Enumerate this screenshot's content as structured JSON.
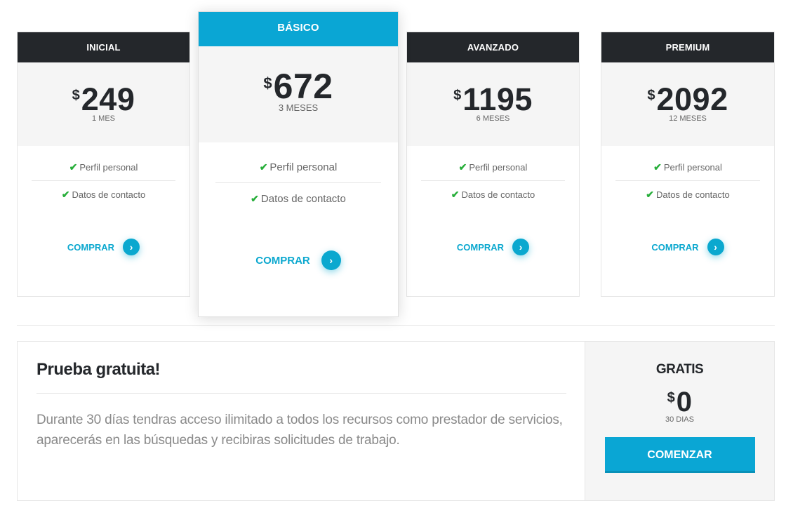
{
  "plans": [
    {
      "name": "INICIAL",
      "currency": "$",
      "amount": "249",
      "period": "1 MES",
      "features": [
        "Perfil personal",
        "Datos de contacto"
      ],
      "cta": "COMPRAR"
    },
    {
      "name": "BÁSICO",
      "currency": "$",
      "amount": "672",
      "period": "3 MESES",
      "features": [
        "Perfil personal",
        "Datos de contacto"
      ],
      "cta": "COMPRAR"
    },
    {
      "name": "AVANZADO",
      "currency": "$",
      "amount": "1195",
      "period": "6 MESES",
      "features": [
        "Perfil personal",
        "Datos de contacto"
      ],
      "cta": "COMPRAR"
    },
    {
      "name": "PREMIUM",
      "currency": "$",
      "amount": "2092",
      "period": "12 MESES",
      "features": [
        "Perfil personal",
        "Datos de contacto"
      ],
      "cta": "COMPRAR"
    }
  ],
  "trial": {
    "title": "Prueba gratuita!",
    "description": "Durante 30 días tendras acceso ilimitado a todos los recursos como prestador de servicios, aparecerás en las búsquedas y recibiras solicitudes de trabajo.",
    "label": "GRATIS",
    "currency": "$",
    "amount": "0",
    "period": "30 DIAS",
    "cta": "COMENZAR"
  },
  "icons": {
    "feature": "check-icon",
    "cta": "chevron-right-icon"
  },
  "colors": {
    "accent": "#0aa6d4",
    "dark_header": "#24272b",
    "check": "#27ae3a",
    "price_bg": "#f5f5f5"
  }
}
